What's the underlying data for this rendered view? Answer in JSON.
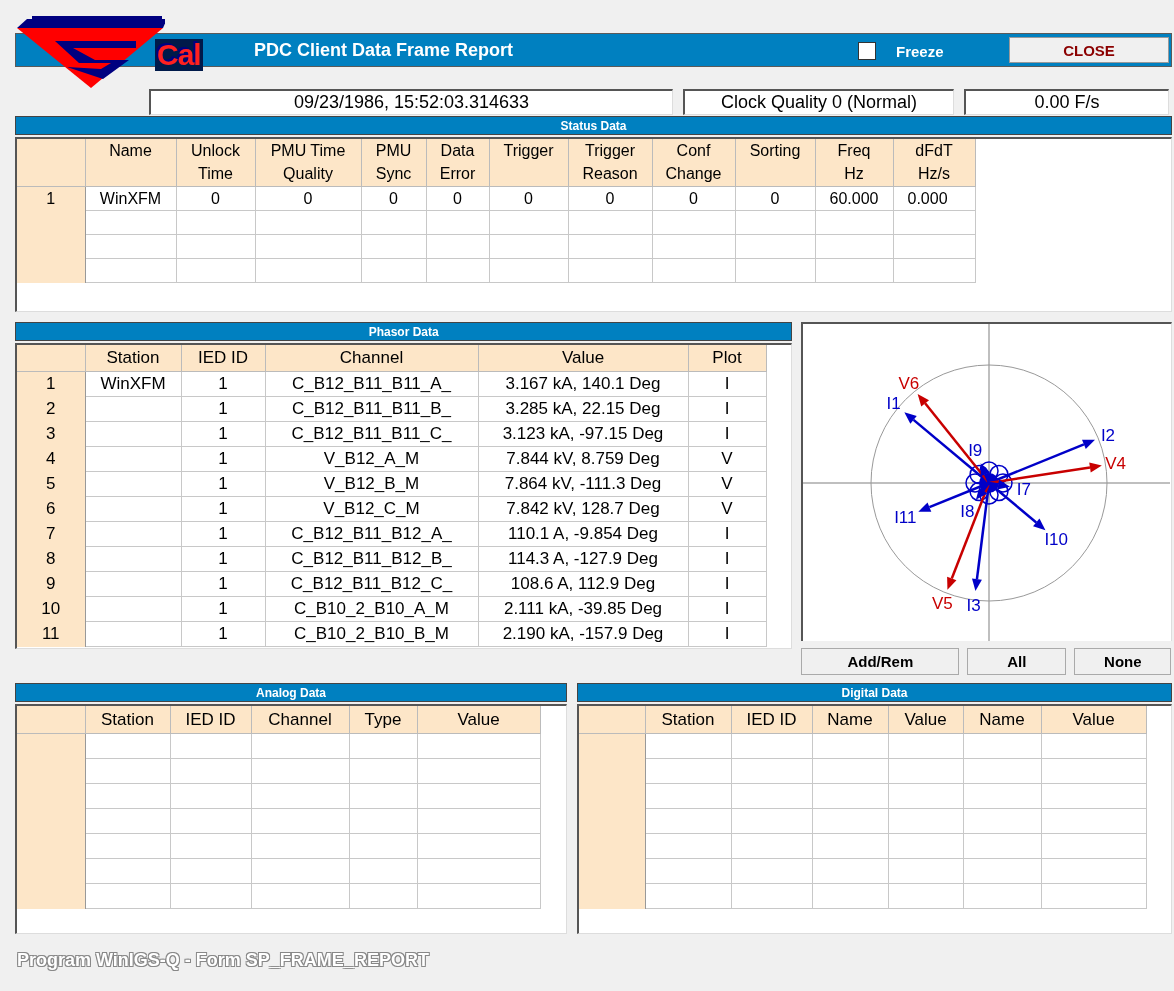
{
  "header": {
    "logo_text": "Cal",
    "title": "PDC Client Data Frame Report",
    "freeze": {
      "label": "Freeze",
      "checked": false
    },
    "close_button": "CLOSE"
  },
  "info": {
    "timestamp": "09/23/1986, 15:52:03.314633",
    "clock_quality": "Clock Quality 0 (Normal)",
    "frame_rate": "0.00 F/s"
  },
  "status_data": {
    "title": "Status Data",
    "columns": [
      "Name",
      "Unlock\nTime",
      "PMU Time\nQuality",
      "PMU\nSync",
      "Data\nError",
      "Trigger",
      "Trigger\nReason",
      "Conf\nChange",
      "Sorting",
      "Freq\nHz",
      "dFdT\nHz/s"
    ],
    "rows": [
      {
        "index": "1",
        "cells": [
          "WinXFM",
          "0",
          "0",
          "0",
          "0",
          "0",
          "0",
          "0",
          "0",
          "60.000",
          "0.000"
        ]
      }
    ]
  },
  "phasor_data": {
    "title": "Phasor Data",
    "columns": [
      "Station",
      "IED ID",
      "Channel",
      "Value",
      "Plot"
    ],
    "rows": [
      {
        "index": "1",
        "station": "WinXFM",
        "ied_id": "1",
        "channel": "C_B12_B11_B11_A_",
        "value": "3.167 kA, 140.1 Deg",
        "plot": "I"
      },
      {
        "index": "2",
        "ied_id": "1",
        "channel": "C_B12_B11_B11_B_",
        "value": "3.285 kA, 22.15 Deg",
        "plot": "I"
      },
      {
        "index": "3",
        "ied_id": "1",
        "channel": "C_B12_B11_B11_C_",
        "value": "3.123 kA, -97.15 Deg",
        "plot": "I"
      },
      {
        "index": "4",
        "ied_id": "1",
        "channel": "V_B12_A_M",
        "value": "7.844 kV, 8.759 Deg",
        "plot": "V"
      },
      {
        "index": "5",
        "ied_id": "1",
        "channel": "V_B12_B_M",
        "value": "7.864 kV, -111.3 Deg",
        "plot": "V"
      },
      {
        "index": "6",
        "ied_id": "1",
        "channel": "V_B12_C_M",
        "value": "7.842 kV, 128.7 Deg",
        "plot": "V"
      },
      {
        "index": "7",
        "ied_id": "1",
        "channel": "C_B12_B11_B12_A_",
        "value": "110.1 A, -9.854 Deg",
        "plot": "I"
      },
      {
        "index": "8",
        "ied_id": "1",
        "channel": "C_B12_B11_B12_B_",
        "value": "114.3 A, -127.9 Deg",
        "plot": "I"
      },
      {
        "index": "9",
        "ied_id": "1",
        "channel": "C_B12_B11_B12_C_",
        "value": "108.6 A, 112.9 Deg",
        "plot": "I"
      },
      {
        "index": "10",
        "ied_id": "1",
        "channel": "C_B10_2_B10_A_M",
        "value": "2.111 kA, -39.85 Deg",
        "plot": "I"
      },
      {
        "index": "11",
        "ied_id": "1",
        "channel": "C_B10_2_B10_B_M",
        "value": "2.190 kA, -157.9 Deg",
        "plot": "I"
      }
    ]
  },
  "phasor_plot": {
    "labels": [
      "I1",
      "I2",
      "I3",
      "V4",
      "V5",
      "V6",
      "I7",
      "I8",
      "I9",
      "I10",
      "I11"
    ],
    "buttons": [
      "Add/Rem",
      "All",
      "None"
    ]
  },
  "analog_data": {
    "title": "Analog Data",
    "columns": [
      "Station",
      "IED ID",
      "Channel",
      "Type",
      "Value"
    ]
  },
  "digital_data": {
    "title": "Digital Data",
    "columns": [
      "Station",
      "IED ID",
      "Name",
      "Value",
      "Name",
      "Value"
    ]
  },
  "footer": "Program WinIGS-Q - Form SP_FRAME_REPORT"
}
